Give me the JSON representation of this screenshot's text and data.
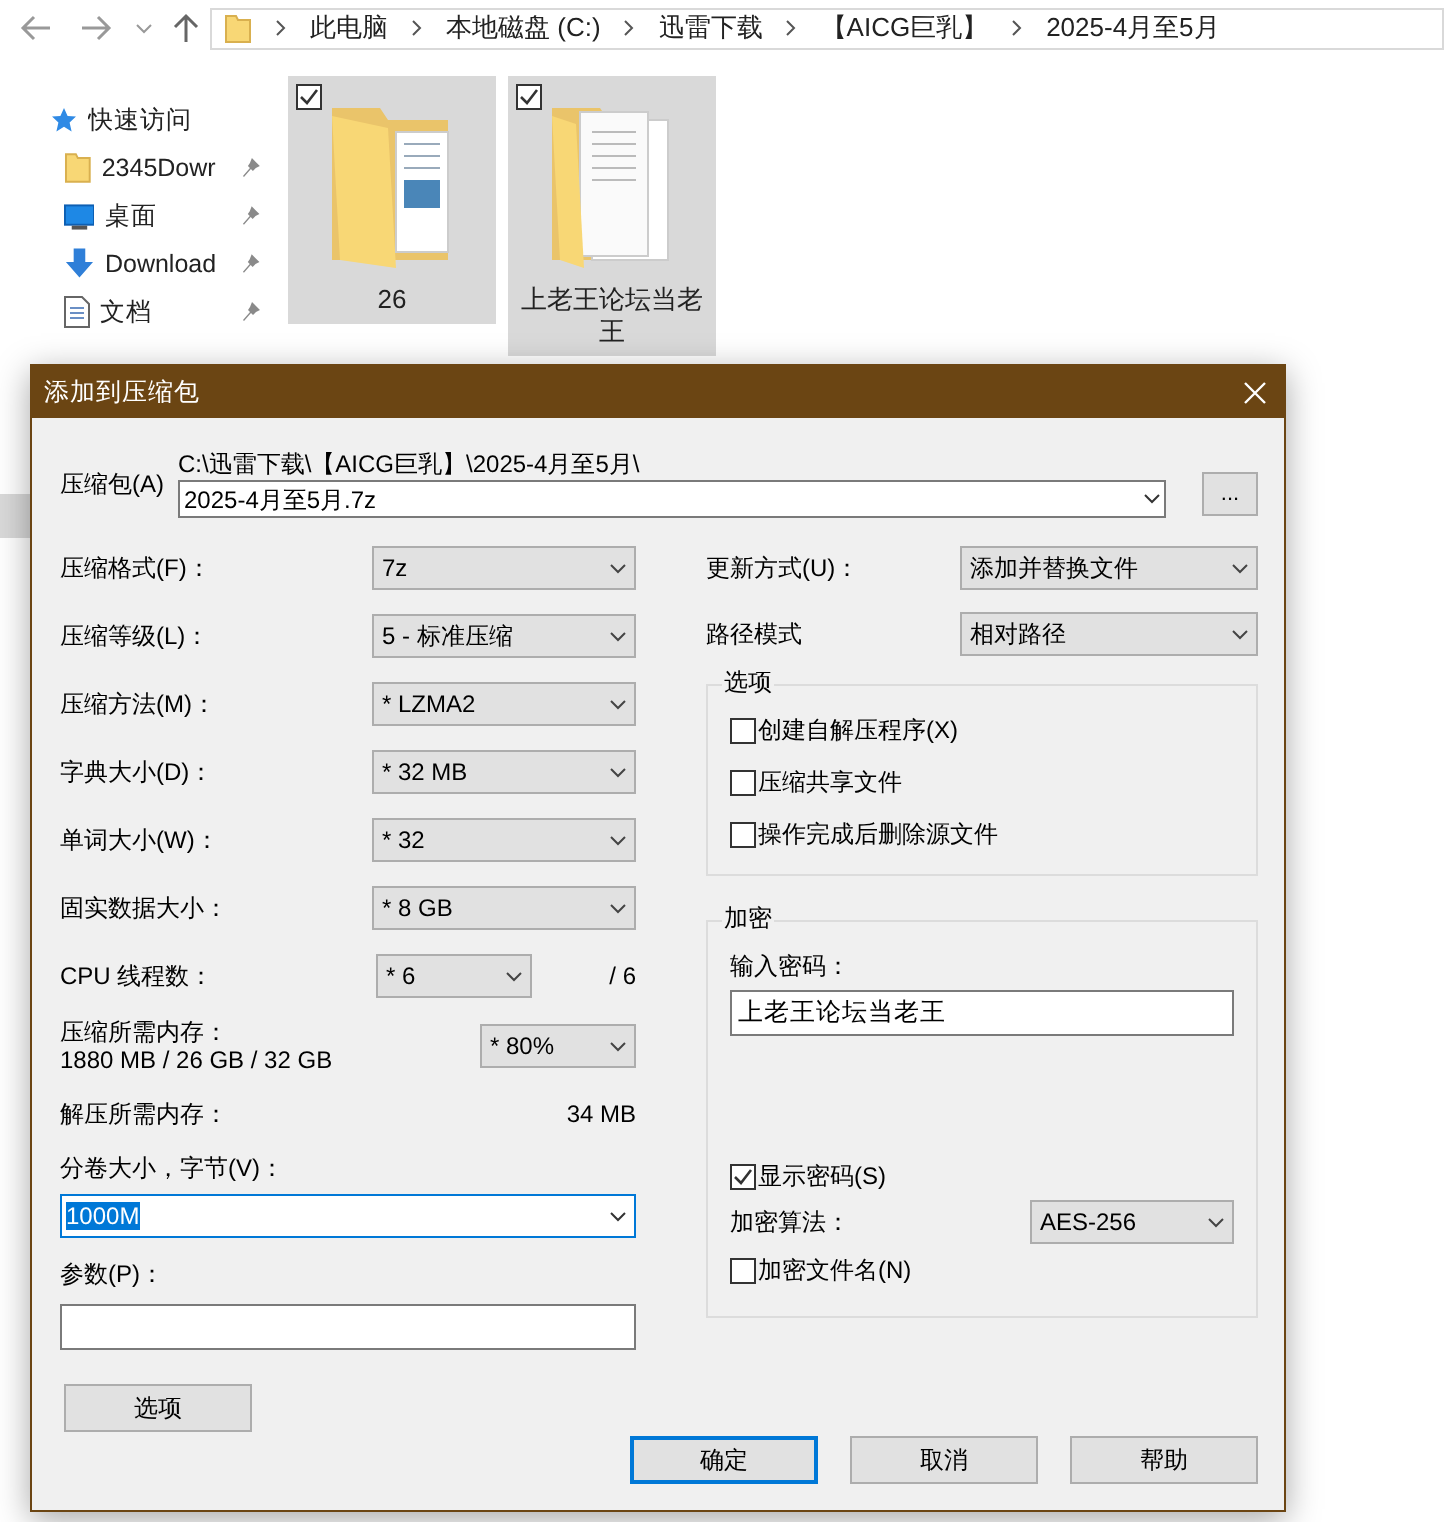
{
  "explorer": {
    "breadcrumb": [
      "此电脑",
      "本地磁盘 (C:)",
      "迅雷下载",
      "【AICG巨乳】",
      "2025-4月至5月"
    ],
    "sidebar": {
      "items": [
        {
          "label": "快速访问",
          "kind": "quick",
          "pinned": false
        },
        {
          "label": "2345Dowr",
          "kind": "folder",
          "pinned": true
        },
        {
          "label": "桌面",
          "kind": "desktop",
          "pinned": true
        },
        {
          "label": "Download",
          "kind": "download",
          "pinned": true
        },
        {
          "label": "文档",
          "kind": "document",
          "pinned": true
        }
      ]
    },
    "folders": [
      {
        "name": "26",
        "kind": "pictures",
        "selected": true,
        "checked": true
      },
      {
        "name": "上老王论坛当老王",
        "kind": "documents",
        "selected": true,
        "checked": true
      }
    ]
  },
  "dialog": {
    "title": "添加到压缩包",
    "archive": {
      "label": "压缩包(A)",
      "path": "C:\\迅雷下载\\【AICG巨乳】\\2025-4月至5月\\",
      "value": "2025-4月至5月.7z",
      "browse": "..."
    },
    "left": [
      {
        "kind": "select",
        "label": "压缩格式(F)：",
        "value": "7z"
      },
      {
        "kind": "select",
        "label": "压缩等级(L)：",
        "value": "5 - 标准压缩"
      },
      {
        "kind": "select",
        "label": "压缩方法(M)：",
        "value": "* LZMA2"
      },
      {
        "kind": "select",
        "label": "字典大小(D)：",
        "value": "* 32 MB"
      },
      {
        "kind": "select",
        "label": "单词大小(W)：",
        "value": "* 32"
      },
      {
        "kind": "select",
        "label": "固实数据大小：",
        "value": "* 8 GB"
      },
      {
        "kind": "cpu",
        "label": "CPU 线程数：",
        "value": "* 6",
        "suffix": "/ 6"
      },
      {
        "kind": "memory",
        "label": "压缩所需内存：",
        "sublabel": "1880 MB / 26 GB / 32 GB",
        "value": "* 80%"
      },
      {
        "kind": "info",
        "label": "解压所需内存：",
        "value": "34 MB"
      }
    ],
    "volume": {
      "label": "分卷大小，字节(V)：",
      "value": "1000M"
    },
    "params": {
      "label": "参数(P)："
    },
    "options_button": "选项",
    "right": [
      {
        "label": "更新方式(U)：",
        "value": "添加并替换文件"
      },
      {
        "label": "路径模式",
        "value": "相对路径"
      }
    ],
    "options": {
      "title": "选项",
      "checkboxes": [
        {
          "label": "创建自解压程序(X)",
          "checked": false
        },
        {
          "label": "压缩共享文件",
          "checked": false
        },
        {
          "label": "操作完成后删除源文件",
          "checked": false
        }
      ]
    },
    "encryption": {
      "title": "加密",
      "password_label": "输入密码：",
      "password": "上老王论坛当老王",
      "show_password": {
        "label": "显示密码(S)",
        "checked": true
      },
      "method_label": "加密算法：",
      "method": "AES-256",
      "encrypt_names": {
        "label": "加密文件名(N)",
        "checked": false
      }
    },
    "buttons": [
      {
        "label": "确定",
        "default": true
      },
      {
        "label": "取消",
        "default": false
      },
      {
        "label": "帮助",
        "default": false
      }
    ]
  }
}
